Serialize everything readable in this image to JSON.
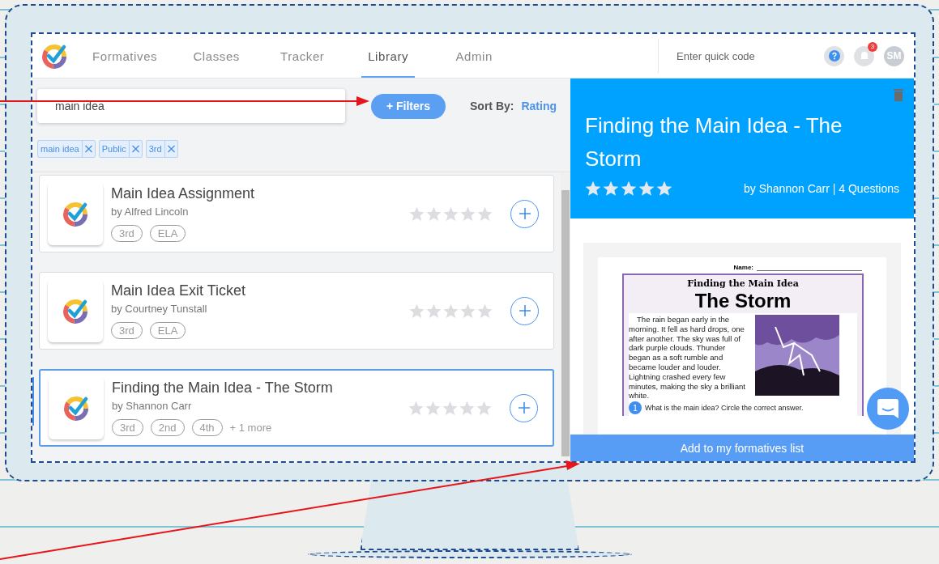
{
  "nav": {
    "tabs": [
      {
        "label": "Formatives",
        "selected": false
      },
      {
        "label": "Classes",
        "selected": false
      },
      {
        "label": "Tracker",
        "selected": false
      },
      {
        "label": "Library",
        "selected": true
      },
      {
        "label": "Admin",
        "selected": false
      }
    ],
    "quick_code": {
      "placeholder": "Enter quick code"
    },
    "notification_count": "3",
    "avatar": "SM"
  },
  "search": {
    "value": "main idea",
    "filters_button": "+ Filters",
    "sort_label": "Sort By:",
    "sort_value": "Rating"
  },
  "chips": [
    "main idea",
    "Public",
    "3rd"
  ],
  "results": [
    {
      "title": "Main Idea Assignment",
      "author": "by Alfred Lincoln",
      "tags": [
        "3rd",
        "ELA"
      ],
      "stars": 0,
      "selected": false
    },
    {
      "title": "Main Idea Exit Ticket",
      "author": "by Courtney Tunstall",
      "tags": [
        "3rd",
        "ELA"
      ],
      "stars": 0,
      "selected": false
    },
    {
      "title": "Finding the Main Idea - The Storm",
      "author": "by Shannon Carr",
      "tags": [
        "3rd",
        "2nd",
        "4th"
      ],
      "more": "+ 1 more",
      "stars": 0,
      "selected": true
    }
  ],
  "preview": {
    "title": "Finding the Main Idea - The Storm",
    "stars": 5,
    "byline": "by Shannon Carr | 4 Questions",
    "worksheet": {
      "name_label": "Name:",
      "heading": "Finding the Main Idea",
      "title": "The Storm",
      "passage": "The rain began early in the morning. It fell as hard drops, one after another. The sky was full of dark purple clouds. Thunder began as a soft rumble and became louder and louder. Lightning crashed every few minutes, making the sky a brilliant white.",
      "question_number": "1",
      "question": "What is the main idea? Circle the correct answer."
    },
    "add_button": "Add to my formatives list"
  }
}
